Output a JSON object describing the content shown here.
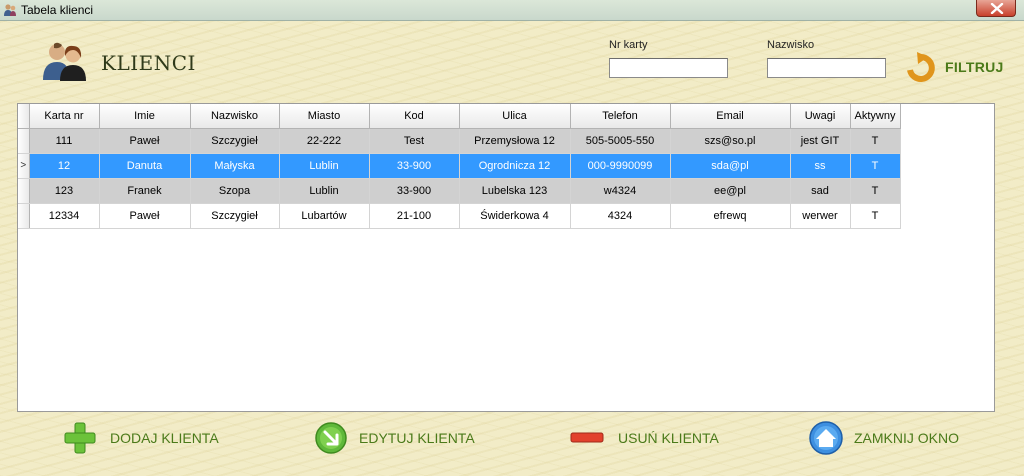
{
  "window": {
    "title": "Tabela klienci"
  },
  "header": {
    "title": "KLIENCI",
    "icon": "users-icon"
  },
  "filters": {
    "card_label": "Nr karty",
    "card_value": "",
    "surname_label": "Nazwisko",
    "surname_value": "",
    "filter_button": "FILTRUJ"
  },
  "grid": {
    "columns": [
      "Karta nr",
      "Imie",
      "Nazwisko",
      "Miasto",
      "Kod",
      "Ulica",
      "Telefon",
      "Email",
      "Uwagi",
      "Aktywny"
    ],
    "current_row_marker": ">",
    "rows": [
      {
        "cells": [
          "111",
          "Paweł",
          "Szczygieł",
          "22-222",
          "Test",
          "Przemysłowa 12",
          "505-5005-550",
          "szs@so.pl",
          "jest GIT",
          "T"
        ],
        "selected": false
      },
      {
        "cells": [
          "12",
          "Danuta",
          "Małyska",
          "Lublin",
          "33-900",
          "Ogrodnicza 12",
          "000-9990099",
          "sda@pl",
          "ss",
          "T"
        ],
        "selected": true
      },
      {
        "cells": [
          "123",
          "Franek",
          "Szopa",
          "Lublin",
          "33-900",
          "Lubelska 123",
          "w4324",
          "ee@pl",
          "sad",
          "T"
        ],
        "selected": false
      },
      {
        "cells": [
          "12334",
          "Paweł",
          "Szczygieł",
          "Lubartów",
          "21-100",
          "Świderkowa 4",
          "4324",
          "efrewq",
          "werwer",
          "T"
        ],
        "selected": false
      }
    ]
  },
  "actions": {
    "add": "DODAJ KLIENTA",
    "edit": "EDYTUJ KLIENTA",
    "delete": "USUŃ KLIENTA",
    "close": "ZAMKNIJ OKNO"
  },
  "colors": {
    "accent_green": "#4b7a1a",
    "selection": "#3399ff",
    "row_alt": "#cfcfcf"
  }
}
